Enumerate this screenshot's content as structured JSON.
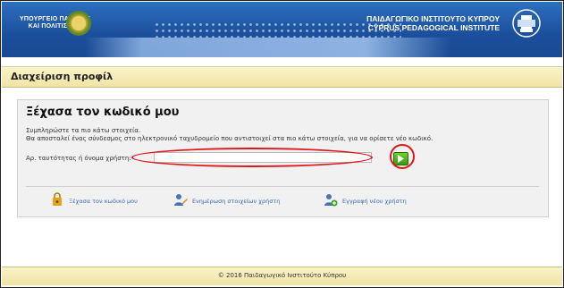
{
  "header": {
    "ministry_line1": "ΥΠΟΥΡΓΕΙΟ ΠΑΙΔΕΙΑΣ",
    "ministry_line2": "ΚΑΙ ΠΟΛΙΤΙΣΜΟΥ",
    "institute_line1": "ΠΑΙΔΑΓΩΓΙΚΟ ΙΝΣΤΙΤΟΥΤΟ ΚΥΠΡΟΥ",
    "institute_line2": "CYPRUS PEDAGOGICAL INSTITUTE"
  },
  "page": {
    "title": "Διαχείριση προφίλ"
  },
  "panel": {
    "heading": "Ξέχασα τον κωδικό μου",
    "instruction_line1": "Συμπληρώστε τα πιο κάτω στοιχεία.",
    "instruction_line2": "Θα αποσταλεί ένας σύνδεσμος στο ηλεκτρονικό ταχυδρομείο που αντιστοιχεί στα πιο κάτω στοιχεία, για να ορίσετε νέο κωδικό.",
    "field_label": "Αρ. ταυτότητας ή όνομα χρήστη:",
    "field_value": ""
  },
  "links": [
    {
      "label": "Ξέχασα τον κωδικό μου",
      "icon": "lock-icon"
    },
    {
      "label": "Ενημέρωση στοιχείων χρήστη",
      "icon": "user-edit-icon"
    },
    {
      "label": "Εγγραφή νέου χρήστη",
      "icon": "user-add-icon"
    }
  ],
  "footer": {
    "text": "© 2016 Παιδαγωγικό Ινστιτούτο Κύπρου"
  },
  "colors": {
    "header_blue": "#1b4f9c",
    "title_bar": "#f5ebb8",
    "go_button": "#4caf1e",
    "annotation_red": "#e0161a",
    "link_blue": "#3a6ab0"
  }
}
